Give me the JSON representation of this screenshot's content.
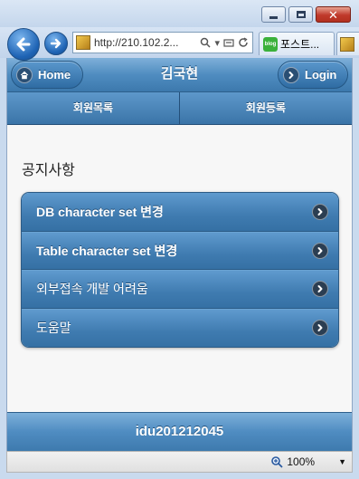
{
  "browser": {
    "address_url": "http://210.102.2...",
    "tabs": [
      {
        "label": "포스트..."
      },
      {
        "label": ""
      }
    ],
    "favicon_label": "blog",
    "zoom_level": "100%"
  },
  "page": {
    "header": {
      "title": "김국현",
      "home_label": "Home",
      "login_label": "Login"
    },
    "nav_tabs": [
      {
        "label": "회원목록"
      },
      {
        "label": "회원등록"
      }
    ],
    "section_title": "공지사항",
    "notices": [
      {
        "label": "DB character set 변경"
      },
      {
        "label": "Table character set 변경"
      },
      {
        "label": "외부접속 개발 어려움"
      },
      {
        "label": "도움말"
      }
    ],
    "footer_text": "idu201212045"
  },
  "colors": {
    "accent": "#3f7bb0",
    "header": "#4f8cc0",
    "background": "#f7f7f7"
  }
}
